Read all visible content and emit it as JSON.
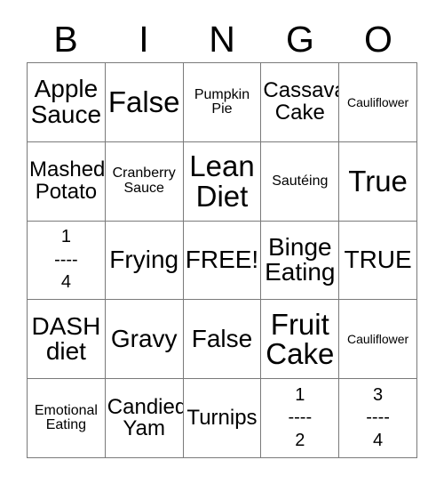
{
  "header": {
    "letters": [
      "B",
      "I",
      "N",
      "G",
      "O"
    ]
  },
  "grid": {
    "rows": [
      [
        {
          "text": "Apple\nSauce",
          "size": "fs-lg"
        },
        {
          "text": "False",
          "size": "fs-xl"
        },
        {
          "text": "Pumpkin\nPie",
          "size": "fs-sm"
        },
        {
          "text": "Cassava\nCake",
          "size": "fs-md"
        },
        {
          "text": "Cauliflower",
          "size": "fs-xs"
        }
      ],
      [
        {
          "text": "Mashed\nPotato",
          "size": "fs-md"
        },
        {
          "text": "Cranberry\nSauce",
          "size": "fs-sm"
        },
        {
          "text": "Lean\nDiet",
          "size": "fs-xl"
        },
        {
          "text": "Sautéing",
          "size": "fs-sm"
        },
        {
          "text": "True",
          "size": "fs-xl"
        }
      ],
      [
        {
          "text": "1\n----\n4",
          "size": "frac"
        },
        {
          "text": "Frying",
          "size": "fs-lg"
        },
        {
          "text": "FREE!",
          "size": "fs-lg"
        },
        {
          "text": "Binge\nEating",
          "size": "fs-lg"
        },
        {
          "text": "TRUE",
          "size": "fs-lg"
        }
      ],
      [
        {
          "text": "DASH\ndiet",
          "size": "fs-lg"
        },
        {
          "text": "Gravy",
          "size": "fs-lg"
        },
        {
          "text": "False",
          "size": "fs-lg"
        },
        {
          "text": "Fruit\nCake",
          "size": "fs-xl"
        },
        {
          "text": "Cauliflower",
          "size": "fs-xs"
        }
      ],
      [
        {
          "text": "Emotional\nEating",
          "size": "fs-sm"
        },
        {
          "text": "Candied\nYam",
          "size": "fs-md"
        },
        {
          "text": "Turnips",
          "size": "fs-md"
        },
        {
          "text": "1\n----\n2",
          "size": "frac"
        },
        {
          "text": "3\n----\n4",
          "size": "frac"
        }
      ]
    ]
  }
}
